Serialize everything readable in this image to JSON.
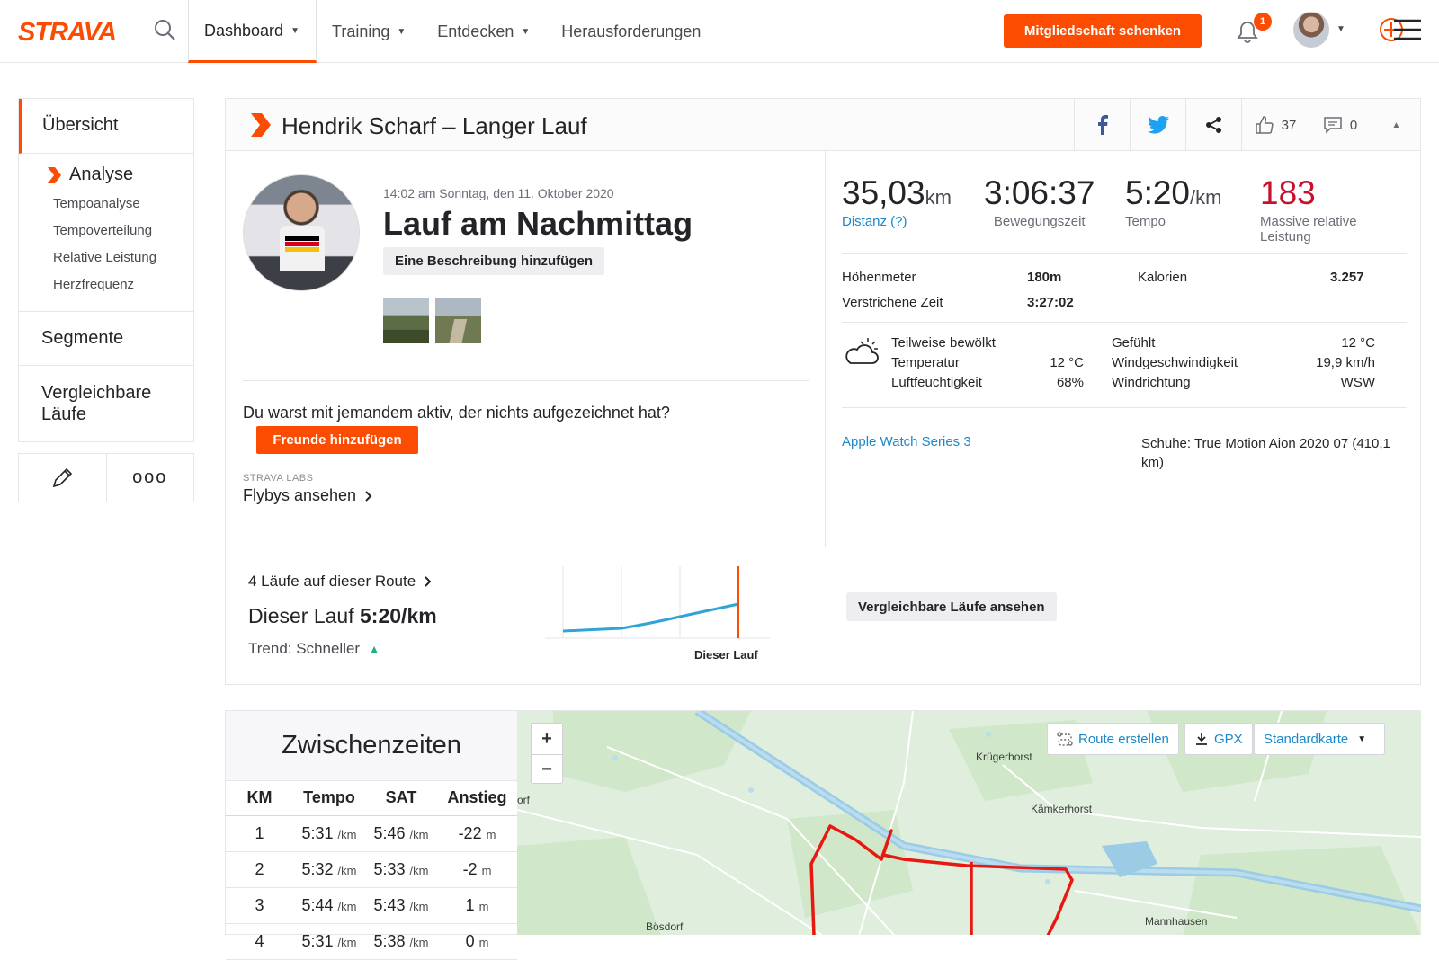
{
  "header": {
    "logo": "STRAVA",
    "nav": [
      {
        "label": "Dashboard",
        "chevron": true,
        "active": true
      },
      {
        "label": "Training",
        "chevron": true,
        "active": false
      },
      {
        "label": "Entdecken",
        "chevron": true,
        "active": false
      },
      {
        "label": "Herausforderungen",
        "chevron": false,
        "active": false
      }
    ],
    "gift_button": "Mitgliedschaft schenken",
    "notification_count": "1"
  },
  "sidebar": {
    "overview": "Übersicht",
    "analysis": "Analyse",
    "analysis_items": [
      "Tempoanalyse",
      "Tempoverteilung",
      "Relative Leistung",
      "Herzfrequenz"
    ],
    "segments": "Segmente",
    "comparable": "Vergleichbare Läufe",
    "more_glyph": "ooo"
  },
  "activity": {
    "title": "Hendrik Scharf – Langer Lauf",
    "kudos": "37",
    "comments": "0",
    "date": "14:02 am Sonntag, den 11. Oktober 2020",
    "name": "Lauf am Nachmittag",
    "add_description": "Eine Beschreibung hinzufügen",
    "with_question": "Du warst mit jemandem aktiv, der nichts aufgezeichnet hat?",
    "add_friends": "Freunde hinzufügen",
    "labs": "STRAVA LABS",
    "flybys": "Flybys ansehen"
  },
  "stats": {
    "distance": {
      "value": "35,03",
      "unit": "km",
      "label": "Distanz (?)"
    },
    "moving_time": {
      "value": "3:06:37",
      "label": "Bewegungszeit"
    },
    "pace": {
      "value": "5:20",
      "unit": "/km",
      "label": "Tempo"
    },
    "relative_effort": {
      "value": "183",
      "label": "Massive relative Leistung"
    },
    "elevation_label": "Höhenmeter",
    "elevation_value": "180m",
    "calories_label": "Kalorien",
    "calories_value": "3.257",
    "elapsed_label": "Verstrichene Zeit",
    "elapsed_value": "3:27:02"
  },
  "weather": {
    "condition": "Teilweise bewölkt",
    "temperature_label": "Temperatur",
    "temperature_value": "12 °C",
    "humidity_label": "Luftfeuchtigkeit",
    "humidity_value": "68%",
    "feels_label": "Gefühlt",
    "feels_value": "12 °C",
    "wind_speed_label": "Windgeschwindigkeit",
    "wind_speed_value": "19,9 km/h",
    "wind_dir_label": "Windrichtung",
    "wind_dir_value": "WSW"
  },
  "gear": {
    "device": "Apple Watch Series 3",
    "shoes": "Schuhe: True Motion Aion 2020 07 (410,1 km)"
  },
  "route_compare": {
    "runs_on_route": "4 Läufe auf dieser Route",
    "this_run_label": "Dieser Lauf",
    "this_run_pace": "5:20/km",
    "trend": "Trend: Schneller",
    "chart_label": "Dieser Lauf",
    "compare_button": "Vergleichbare Läufe ansehen",
    "accent": "#fc4c02",
    "line_color": "#2fa5d6"
  },
  "splits": {
    "title": "Zwischenzeiten",
    "columns": [
      "KM",
      "Tempo",
      "SAT",
      "Anstieg"
    ],
    "pace_unit": "/km",
    "elev_unit": "m",
    "rows": [
      {
        "km": "1",
        "pace": "5:31",
        "sat": "5:46",
        "elev": "-22"
      },
      {
        "km": "2",
        "pace": "5:32",
        "sat": "5:33",
        "elev": "-2"
      },
      {
        "km": "3",
        "pace": "5:44",
        "sat": "5:43",
        "elev": "1"
      },
      {
        "km": "4",
        "pace": "5:31",
        "sat": "5:38",
        "elev": "0"
      }
    ]
  },
  "map": {
    "zoom_in": "+",
    "zoom_out": "−",
    "create_route": "Route erstellen",
    "gpx": "GPX",
    "map_type": "Standardkarte",
    "places": [
      "Krügerhorst",
      "Kämkerhorst",
      "Mannhausen",
      "Bösdorf",
      "orf"
    ],
    "route_color": "#e8170f"
  },
  "colors": {
    "brand": "#fc4c02",
    "effort": "#c8102e",
    "link": "#1a88c9"
  }
}
